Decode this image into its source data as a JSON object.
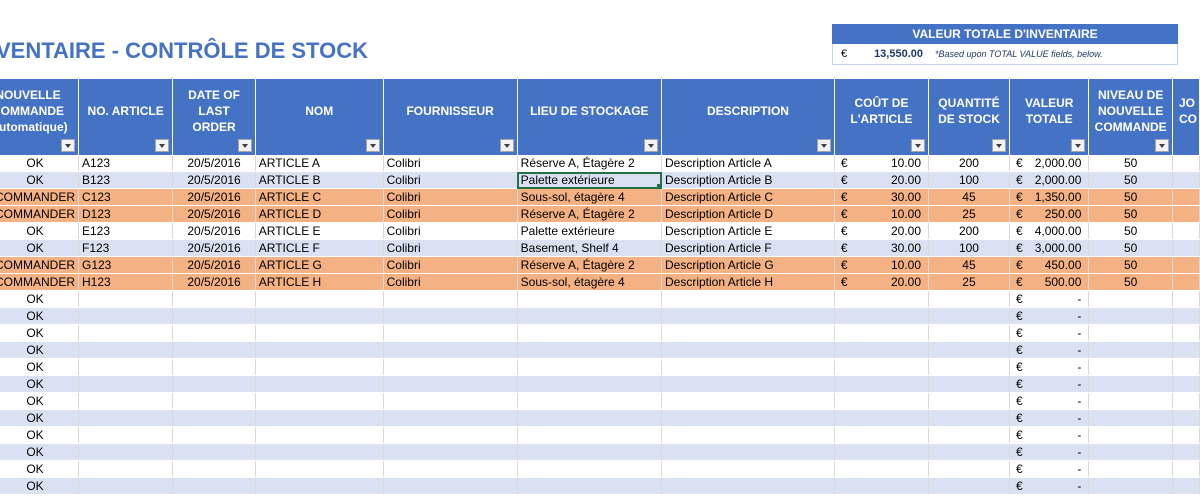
{
  "sheet": {
    "title": "INVENTAIRE - CONTRÔLE DE STOCK"
  },
  "total_value": {
    "header": "VALEUR TOTALE D'INVENTAIRE",
    "currency": "€",
    "amount": "13,550.00",
    "note": "*Based upon TOTAL VALUE fields, below."
  },
  "columns": [
    {
      "key": "reorder",
      "label": "NOUVELLE COMMANDE (automatique)"
    },
    {
      "key": "article_no",
      "label": "NO. ARTICLE"
    },
    {
      "key": "last_order",
      "label": "DATE OF LAST ORDER"
    },
    {
      "key": "name",
      "label": "NOM"
    },
    {
      "key": "supplier",
      "label": "FOURNISSEUR"
    },
    {
      "key": "location",
      "label": "LIEU DE STOCKAGE"
    },
    {
      "key": "description",
      "label": "DESCRIPTION"
    },
    {
      "key": "unit_cost",
      "label": "COÛT DE L'ARTICLE"
    },
    {
      "key": "qty",
      "label": "QUANTITÉ DE STOCK"
    },
    {
      "key": "total",
      "label": "VALEUR TOTALE"
    },
    {
      "key": "reorder_level",
      "label": "NIVEAU DE NOUVELLE COMMANDE"
    },
    {
      "key": "days",
      "label": "JO CO"
    }
  ],
  "rows": [
    {
      "style": "white",
      "reorder": "OK",
      "article_no": "A123",
      "last_order": "20/5/2016",
      "name": "ARTICLE A",
      "supplier": "Colibri",
      "location": "Réserve A, Étagère 2",
      "description": "Description Article A",
      "cur": "€",
      "unit_cost": "10.00",
      "qty": "200",
      "total": "2,000.00",
      "reorder_level": "50"
    },
    {
      "style": "blue",
      "reorder": "OK",
      "article_no": "B123",
      "last_order": "20/5/2016",
      "name": "ARTICLE B",
      "supplier": "Colibri",
      "location": "Palette extérieure",
      "description": "Description Article B",
      "cur": "€",
      "unit_cost": "20.00",
      "qty": "100",
      "total": "2,000.00",
      "reorder_level": "50"
    },
    {
      "style": "orange",
      "reorder": "COMMANDER",
      "article_no": "C123",
      "last_order": "20/5/2016",
      "name": "ARTICLE C",
      "supplier": "Colibri",
      "location": "Sous-sol, étagère 4",
      "description": "Description Article C",
      "cur": "€",
      "unit_cost": "30.00",
      "qty": "45",
      "total": "1,350.00",
      "reorder_level": "50"
    },
    {
      "style": "orange",
      "reorder": "COMMANDER",
      "article_no": "D123",
      "last_order": "20/5/2016",
      "name": "ARTICLE D",
      "supplier": "Colibri",
      "location": "Réserve  A, Étagère 2",
      "description": "Description Article D",
      "cur": "€",
      "unit_cost": "10.00",
      "qty": "25",
      "total": "250.00",
      "reorder_level": "50"
    },
    {
      "style": "white",
      "reorder": "OK",
      "article_no": "E123",
      "last_order": "20/5/2016",
      "name": "ARTICLE E",
      "supplier": "Colibri",
      "location": "Palette extérieure",
      "description": "Description Article E",
      "cur": "€",
      "unit_cost": "20.00",
      "qty": "200",
      "total": "4,000.00",
      "reorder_level": "50"
    },
    {
      "style": "blue",
      "reorder": "OK",
      "article_no": "F123",
      "last_order": "20/5/2016",
      "name": "ARTICLE F",
      "supplier": "Colibri",
      "location": "Basement, Shelf 4",
      "description": "Description Article F",
      "cur": "€",
      "unit_cost": "30.00",
      "qty": "100",
      "total": "3,000.00",
      "reorder_level": "50"
    },
    {
      "style": "orange",
      "reorder": "COMMANDER",
      "article_no": "G123",
      "last_order": "20/5/2016",
      "name": "ARTICLE G",
      "supplier": "Colibri",
      "location": "Réserve  A, Étagère 2",
      "description": "Description Article G",
      "cur": "€",
      "unit_cost": "10.00",
      "qty": "45",
      "total": "450.00",
      "reorder_level": "50"
    },
    {
      "style": "orange",
      "reorder": "COMMANDER",
      "article_no": "H123",
      "last_order": "20/5/2016",
      "name": "ARTICLE H",
      "supplier": "Colibri",
      "location": "Sous-sol, étagère 4",
      "description": "Description Article H",
      "cur": "€",
      "unit_cost": "20.00",
      "qty": "25",
      "total": "500.00",
      "reorder_level": "50"
    }
  ],
  "empty_rows": {
    "reorder": "OK",
    "cur": "€",
    "total": "-",
    "count": 12
  },
  "colors": {
    "header_blue": "#4472c4",
    "band_blue": "#d9e1f2",
    "reorder_orange": "#f4b183",
    "selection_green": "#217346"
  },
  "selected_cell": {
    "row": 1,
    "column": "location"
  }
}
